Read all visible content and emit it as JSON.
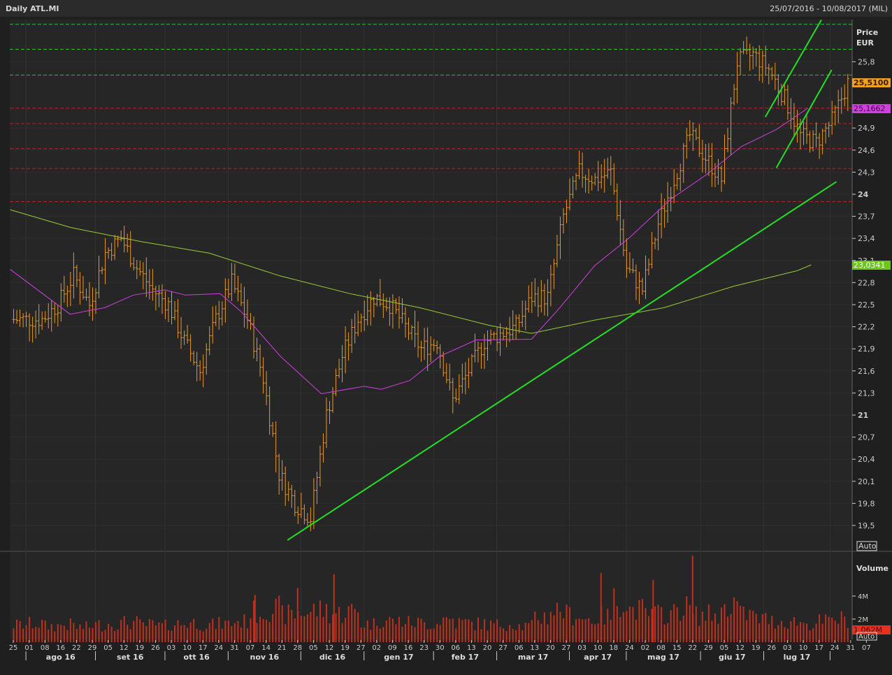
{
  "header": {
    "title": "Daily ATL.MI",
    "range": "25/07/2016 - 10/08/2017 (MIL)"
  },
  "price_panel": {
    "label_line1": "Price",
    "label_line2": "EUR",
    "auto": "Auto"
  },
  "volume_panel": {
    "label": "Volume",
    "auto": "Auto"
  },
  "badges": {
    "last_price": "25,5100",
    "ma_short": "25,1662",
    "ma_long": "23,0341",
    "last_volume": "1,062M"
  },
  "colors": {
    "bars": "#e89a2c",
    "volume": "#c0301c",
    "ma_short": "#d040e0",
    "ma_long": "#9acd32",
    "trend": "#22e022",
    "support": "#b52525",
    "resistance": "#2cc02c",
    "bg": "#262626"
  },
  "chart_data": {
    "type": "ohlc",
    "title": "Daily ATL.MI",
    "ylabel": "Price EUR",
    "ylim": [
      19.2,
      26.45
    ],
    "yticks": [
      "25,8",
      "24,9",
      "24,6",
      "24,3",
      "24",
      "23,7",
      "23,4",
      "23,1",
      "22,8",
      "22,5",
      "22,2",
      "21,9",
      "21,6",
      "21,3",
      "21",
      "20,7",
      "20,4",
      "20,1",
      "19,8",
      "19,5"
    ],
    "ytick_values": [
      25.8,
      24.9,
      24.6,
      24.3,
      24,
      23.7,
      23.4,
      23.1,
      22.8,
      22.5,
      22.2,
      21.9,
      21.6,
      21.3,
      21,
      20.7,
      20.4,
      20.1,
      19.8,
      19.5
    ],
    "xtick_days": [
      "25",
      "01",
      "08",
      "16",
      "22",
      "29",
      "05",
      "12",
      "19",
      "26",
      "03",
      "10",
      "17",
      "24",
      "31",
      "07",
      "14",
      "21",
      "28",
      "05",
      "12",
      "19",
      "27",
      "02",
      "09",
      "16",
      "23",
      "30",
      "06",
      "13",
      "20",
      "27",
      "06",
      "13",
      "20",
      "27",
      "03",
      "10",
      "18",
      "24",
      "02",
      "08",
      "15",
      "22",
      "29",
      "05",
      "12",
      "19",
      "26",
      "03",
      "10",
      "17",
      "24",
      "31",
      "07"
    ],
    "months": [
      {
        "label": "ago 16",
        "start_week": 0.8
      },
      {
        "label": "set 16",
        "start_week": 5.2
      },
      {
        "label": "ott 16",
        "start_week": 9.6
      },
      {
        "label": "nov 16",
        "start_week": 13.6
      },
      {
        "label": "dic 16",
        "start_week": 18.2
      },
      {
        "label": "gen 17",
        "start_week": 22.2
      },
      {
        "label": "feb 17",
        "start_week": 26.6
      },
      {
        "label": "mar 17",
        "start_week": 30.6
      },
      {
        "label": "apr 17",
        "start_week": 35.2
      },
      {
        "label": "mag 17",
        "start_week": 38.8
      },
      {
        "label": "giu 17",
        "start_week": 43.5
      },
      {
        "label": "lug 17",
        "start_week": 47.5
      },
      {
        "label": "",
        "start_week": 51.7
      }
    ],
    "weekly_close": [
      22.3,
      22.3,
      22.5,
      22.9,
      22.5,
      23.2,
      23.4,
      23.0,
      22.7,
      22.5,
      22.0,
      21.6,
      22.3,
      22.8,
      22.3,
      21.5,
      20.2,
      19.8,
      19.6,
      21.0,
      21.8,
      22.3,
      22.6,
      22.5,
      22.2,
      21.9,
      22.0,
      21.2,
      21.6,
      22.0,
      22.1,
      22.2,
      22.6,
      22.6,
      23.7,
      24.3,
      24.2,
      24.3,
      23.0,
      22.7,
      23.6,
      24.2,
      24.8,
      24.5,
      24.2,
      25.8,
      25.9,
      25.7,
      25.3,
      24.8,
      24.7,
      25.0,
      25.51
    ],
    "weekly_volume_M": [
      1.5,
      1.6,
      1.4,
      1.5,
      1.3,
      1.5,
      1.6,
      1.7,
      1.5,
      1.4,
      1.6,
      1.7,
      1.5,
      1.6,
      1.8,
      2.6,
      2.9,
      2.4,
      2.6,
      2.8,
      2.5,
      2.7,
      1.6,
      1.9,
      1.8,
      1.7,
      1.6,
      2.0,
      1.7,
      1.6,
      1.5,
      1.6,
      1.4,
      2.2,
      2.8,
      2.4,
      2.0,
      2.2,
      3.6,
      2.8,
      2.4,
      2.5,
      3.0,
      2.3,
      2.4,
      3.4,
      2.4,
      2.0,
      1.8,
      1.8,
      1.6,
      1.8,
      2.0
    ],
    "volume_spikes": [
      {
        "week": 15.3,
        "value_M": 4.1
      },
      {
        "week": 18.0,
        "value_M": 4.7
      },
      {
        "week": 20.3,
        "value_M": 5.9
      },
      {
        "week": 37.2,
        "value_M": 6.0
      },
      {
        "week": 40.5,
        "value_M": 5.4
      },
      {
        "week": 43.0,
        "value_M": 7.5
      }
    ],
    "volume_yticks": [
      "4M",
      "2M"
    ],
    "volume_ytick_values": [
      4,
      2
    ],
    "ma_short": [
      [
        -0.2,
        22.98
      ],
      [
        3.6,
        22.37
      ],
      [
        5.8,
        22.46
      ],
      [
        7.6,
        22.63
      ],
      [
        9.6,
        22.7
      ],
      [
        10.9,
        22.63
      ],
      [
        13.1,
        22.65
      ],
      [
        14.4,
        22.41
      ],
      [
        16.9,
        21.8
      ],
      [
        19.5,
        21.29
      ],
      [
        22.2,
        21.39
      ],
      [
        23.3,
        21.35
      ],
      [
        25.1,
        21.47
      ],
      [
        27.0,
        21.8
      ],
      [
        29.3,
        22.02
      ],
      [
        32.8,
        22.03
      ],
      [
        34.6,
        22.46
      ],
      [
        36.8,
        23.03
      ],
      [
        39.0,
        23.41
      ],
      [
        41.6,
        23.93
      ],
      [
        43.9,
        24.27
      ],
      [
        46.1,
        24.65
      ],
      [
        48.3,
        24.88
      ],
      [
        50.3,
        25.17
      ]
    ],
    "ma_long": [
      [
        -0.2,
        23.79
      ],
      [
        3.6,
        23.55
      ],
      [
        8.0,
        23.36
      ],
      [
        12.4,
        23.2
      ],
      [
        16.9,
        22.89
      ],
      [
        21.3,
        22.65
      ],
      [
        25.7,
        22.46
      ],
      [
        30.1,
        22.22
      ],
      [
        32.8,
        22.11
      ],
      [
        36.8,
        22.29
      ],
      [
        41.2,
        22.46
      ],
      [
        45.6,
        22.75
      ],
      [
        49.6,
        22.96
      ],
      [
        50.5,
        23.04
      ]
    ],
    "trend_lines": [
      [
        [
          17.35,
          19.3
        ],
        [
          52.1,
          24.17
        ]
      ],
      [
        [
          47.6,
          25.05
        ],
        [
          51.15,
          26.37
        ]
      ],
      [
        [
          48.3,
          24.36
        ],
        [
          51.8,
          25.69
        ]
      ]
    ],
    "resistance_levels": [
      26.31,
      25.97,
      25.62
    ],
    "support_levels": [
      25.17,
      24.96,
      24.62,
      24.35,
      23.9
    ]
  }
}
